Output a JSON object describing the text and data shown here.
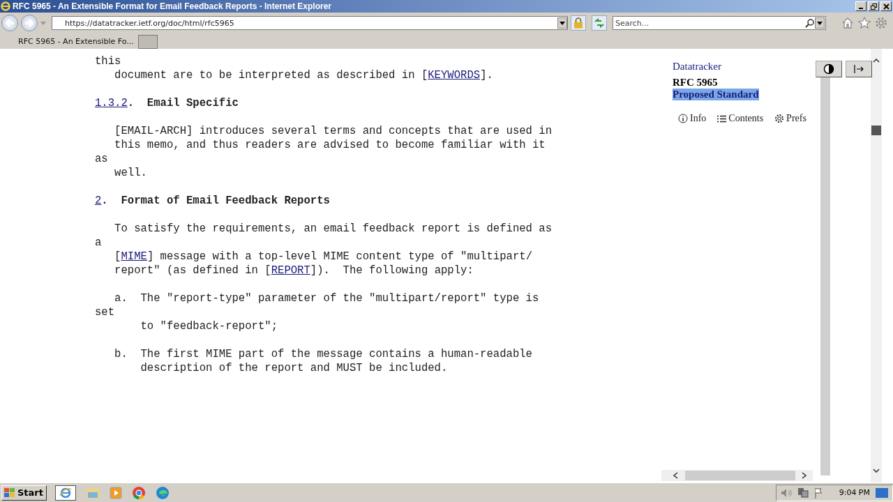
{
  "window": {
    "title": "RFC 5965 - An Extensible Format for Email Feedback Reports - Internet Explorer"
  },
  "address_bar": {
    "url": "https://datatracker.ietf.org/doc/html/rfc5965"
  },
  "search": {
    "placeholder": "Search..."
  },
  "tabs": [
    {
      "label": "RFC 5965 - An Extensible Fo...",
      "selected": true
    }
  ],
  "document": {
    "paragraphs": [
      {
        "lines": [
          [
            {
              "kind": "text",
              "text": "this"
            }
          ],
          [
            {
              "kind": "text",
              "text": "   document are to be interpreted as described in ["
            },
            {
              "kind": "link",
              "text": "KEYWORDS"
            },
            {
              "kind": "text",
              "text": "]."
            }
          ]
        ]
      },
      {
        "lines": [
          [
            {
              "kind": "link",
              "text": "1.3.2"
            },
            {
              "kind": "bold",
              "text": ".  Email Specific"
            }
          ]
        ]
      },
      {
        "lines": [
          [
            {
              "kind": "text",
              "text": "   [EMAIL-ARCH] introduces several terms and concepts that are used in"
            }
          ],
          [
            {
              "kind": "text",
              "text": "   this memo, and thus readers are advised to become familiar with it"
            }
          ],
          [
            {
              "kind": "text",
              "text": "as"
            }
          ],
          [
            {
              "kind": "text",
              "text": "   well."
            }
          ]
        ]
      },
      {
        "lines": [
          [
            {
              "kind": "link",
              "text": "2"
            },
            {
              "kind": "bold",
              "text": ".  Format of Email Feedback Reports"
            }
          ]
        ]
      },
      {
        "lines": [
          [
            {
              "kind": "text",
              "text": "   To satisfy the requirements, an email feedback report is defined as"
            }
          ],
          [
            {
              "kind": "text",
              "text": "a"
            }
          ],
          [
            {
              "kind": "text",
              "text": "   ["
            },
            {
              "kind": "link",
              "text": "MIME"
            },
            {
              "kind": "text",
              "text": "] message with a top-level MIME content type of \"multipart/"
            }
          ],
          [
            {
              "kind": "text",
              "text": "   report\" (as defined in ["
            },
            {
              "kind": "link",
              "text": "REPORT"
            },
            {
              "kind": "text",
              "text": "]).  The following apply:"
            }
          ]
        ]
      },
      {
        "lines": [
          [
            {
              "kind": "text",
              "text": "   a.  The \"report-type\" parameter of the \"multipart/report\" type is"
            }
          ],
          [
            {
              "kind": "text",
              "text": "set"
            }
          ],
          [
            {
              "kind": "text",
              "text": "       to \"feedback-report\";"
            }
          ]
        ]
      },
      {
        "lines": [
          [
            {
              "kind": "text",
              "text": "   b.  The first MIME part of the message contains a human-readable"
            }
          ],
          [
            {
              "kind": "text",
              "text": "       description of the report and MUST be included."
            }
          ]
        ]
      }
    ]
  },
  "sidebar": {
    "site_link": "Datatracker",
    "rfc": "RFC 5965",
    "status": {
      "text": "Proposed Standard",
      "highlighted": true
    },
    "links": [
      {
        "kind": "info",
        "label": "Info"
      },
      {
        "kind": "contents",
        "label": "Contents"
      },
      {
        "kind": "prefs",
        "label": "Prefs"
      }
    ]
  },
  "taskbar": {
    "start": "Start",
    "time": "9:04 PM"
  }
}
